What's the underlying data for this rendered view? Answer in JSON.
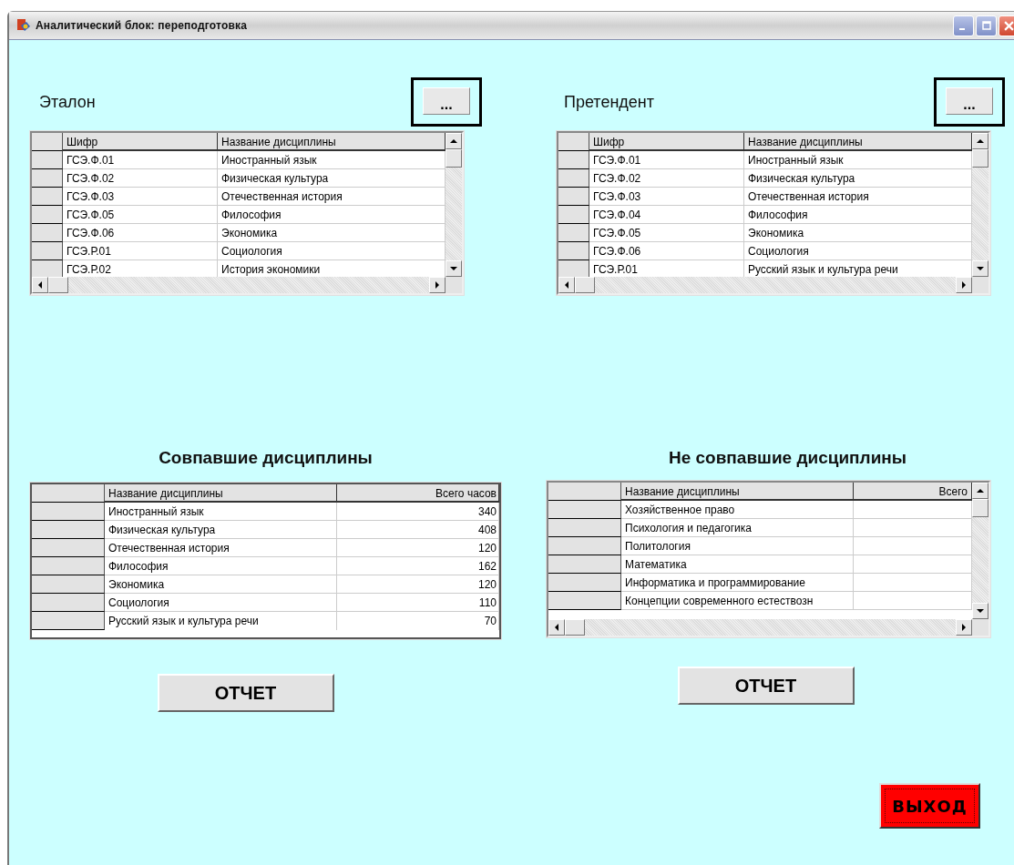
{
  "window": {
    "title": "Аналитический блок: переподготовка"
  },
  "panels": [
    {
      "title": "Эталон",
      "browse_button": "...",
      "table": {
        "columns": [
          "Шифр",
          "Название дисциплины"
        ],
        "rows": [
          [
            "ГСЭ.Ф.01",
            "Иностранный язык"
          ],
          [
            "ГСЭ.Ф.02",
            "Физическая культура"
          ],
          [
            "ГСЭ.Ф.03",
            "Отечественная история"
          ],
          [
            "ГСЭ.Ф.05",
            "Философия"
          ],
          [
            "ГСЭ.Ф.06",
            "Экономика"
          ],
          [
            "ГСЭ.Р.01",
            "Социология"
          ],
          [
            "ГСЭ.Р.02",
            "История экономики"
          ]
        ]
      }
    },
    {
      "title": "Претендент",
      "browse_button": "...",
      "table": {
        "columns": [
          "Шифр",
          "Название дисциплины"
        ],
        "rows": [
          [
            "ГСЭ.Ф.01",
            "Иностранный язык"
          ],
          [
            "ГСЭ.Ф.02",
            "Физическая культура"
          ],
          [
            "ГСЭ.Ф.03",
            "Отечественная история"
          ],
          [
            "ГСЭ.Ф.04",
            "Философия"
          ],
          [
            "ГСЭ.Ф.05",
            "Экономика"
          ],
          [
            "ГСЭ.Ф.06",
            "Социология"
          ],
          [
            "ГСЭ.Р.01",
            "Русский язык и культура речи"
          ]
        ]
      }
    }
  ],
  "results": [
    {
      "title": "Совпавшие дисциплины",
      "report_button": "ОТЧЕТ",
      "table": {
        "columns": [
          "Название дисциплины",
          "Всего часов"
        ],
        "rows": [
          [
            "Иностранный язык",
            "340"
          ],
          [
            "Физическая культура",
            "408"
          ],
          [
            "Отечественная история",
            "120"
          ],
          [
            "Философия",
            "162"
          ],
          [
            "Экономика",
            "120"
          ],
          [
            "Социология",
            "110"
          ],
          [
            "Русский язык и культура речи",
            "70"
          ]
        ]
      }
    },
    {
      "title": "Не совпавшие дисциплины",
      "report_button": "ОТЧЕТ",
      "table": {
        "columns": [
          "Название дисциплины",
          "Всего"
        ],
        "rows": [
          [
            "Хозяйственное право"
          ],
          [
            "Психология и педагогика"
          ],
          [
            "Политология"
          ],
          [
            "Математика"
          ],
          [
            "Информатика и программирование"
          ],
          [
            "Концепции современного естествозн"
          ]
        ]
      }
    }
  ],
  "exit_button": "ВЫХОД"
}
